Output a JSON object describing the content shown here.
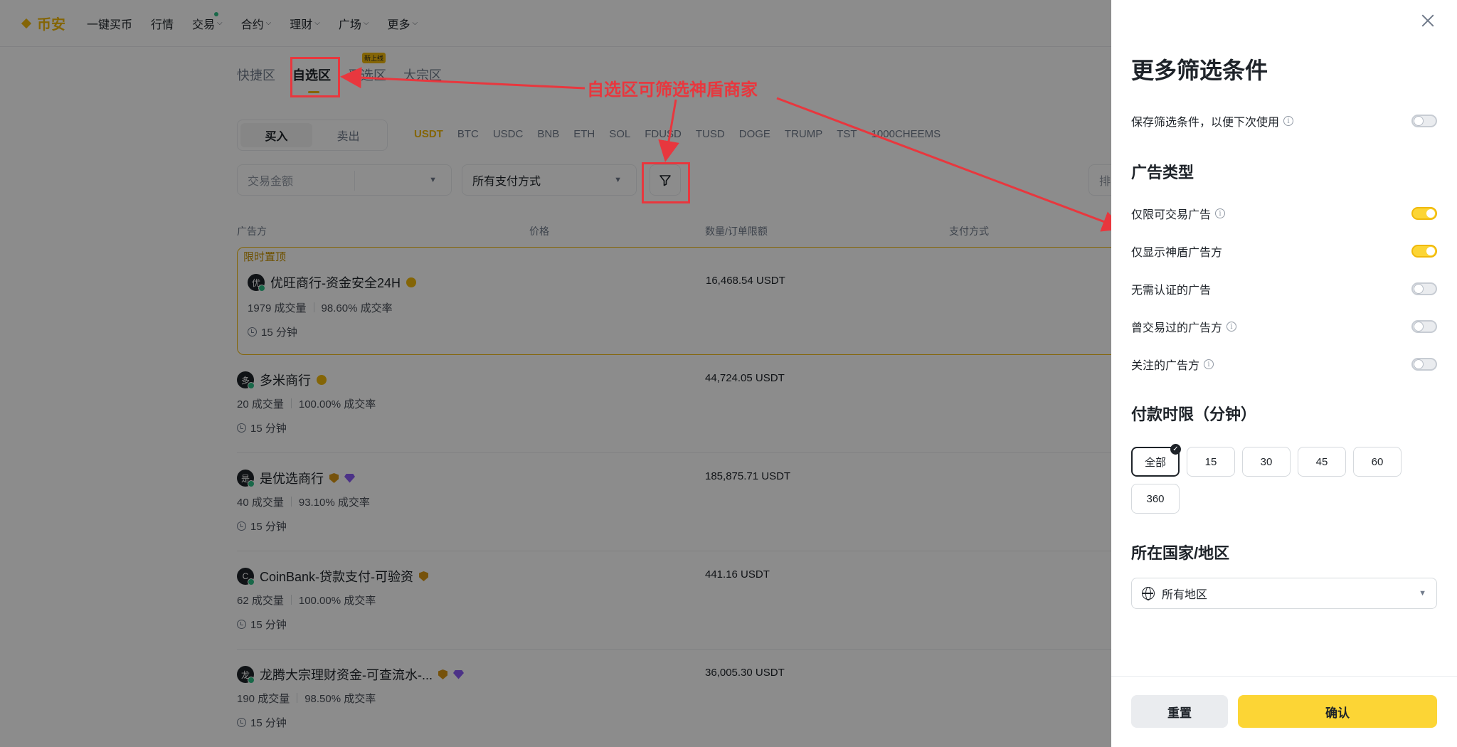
{
  "nav": {
    "logo": "币安",
    "items": [
      {
        "label": "一键买币",
        "chevron": false
      },
      {
        "label": "行情",
        "chevron": false
      },
      {
        "label": "交易",
        "chevron": true
      },
      {
        "label": "合约",
        "chevron": true
      },
      {
        "label": "理财",
        "chevron": true
      },
      {
        "label": "广场",
        "chevron": true
      },
      {
        "label": "更多",
        "chevron": true
      }
    ]
  },
  "zone_tabs": [
    {
      "label": "快捷区",
      "active": false
    },
    {
      "label": "自选区",
      "active": true
    },
    {
      "label": "严选区",
      "active": false,
      "badge": "新上线"
    },
    {
      "label": "大宗区",
      "active": false
    }
  ],
  "trade_toggle": {
    "buy": "买入",
    "sell": "卖出"
  },
  "coins": [
    "USDT",
    "BTC",
    "USDC",
    "BNB",
    "ETH",
    "SOL",
    "FDUSD",
    "TUSD",
    "DOGE",
    "TRUMP",
    "TST",
    "1000CHEEMS"
  ],
  "filters": {
    "amount_placeholder": "交易金额",
    "payment": "所有支付方式",
    "sort_stub": "排"
  },
  "columns": {
    "advertiser": "广告方",
    "price": "价格",
    "quantity": "数量/订单限额",
    "payment": "支付方式"
  },
  "pinned_label": "限时置顶",
  "ads": [
    {
      "initial": "优",
      "name": "优旺商行-资金安全24H",
      "badges": [
        "gold"
      ],
      "trades": "1979 成交量",
      "rate": "98.60% 成交率",
      "time": "15 分钟",
      "quantity": "16,468.54 USDT",
      "pinned": true
    },
    {
      "initial": "多",
      "name": "多米商行",
      "badges": [
        "gold"
      ],
      "trades": "20 成交量",
      "rate": "100.00% 成交率",
      "time": "15 分钟",
      "quantity": "44,724.05 USDT",
      "pinned": false
    },
    {
      "initial": "是",
      "name": "是优选商行",
      "badges": [
        "shield",
        "gem"
      ],
      "trades": "40 成交量",
      "rate": "93.10% 成交率",
      "time": "15 分钟",
      "quantity": "185,875.71 USDT",
      "pinned": false
    },
    {
      "initial": "C",
      "name": "CoinBank-贷款支付-可验资",
      "badges": [
        "shield"
      ],
      "trades": "62 成交量",
      "rate": "100.00% 成交率",
      "time": "15 分钟",
      "quantity": "441.16 USDT",
      "pinned": false
    },
    {
      "initial": "龙",
      "name": "龙腾大宗理财资金-可查流水-...",
      "badges": [
        "shield",
        "gem"
      ],
      "trades": "190 成交量",
      "rate": "98.50% 成交率",
      "time": "15 分钟",
      "quantity": "36,005.30 USDT",
      "pinned": false
    }
  ],
  "annotation": {
    "text": "自选区可筛选神盾商家",
    "color": "#e8373e"
  },
  "drawer": {
    "title": "更多筛选条件",
    "save_filter": {
      "label": "保存筛选条件，以便下次使用",
      "on": false
    },
    "ad_type_title": "广告类型",
    "ad_types": [
      {
        "label": "仅限可交易广告",
        "info": true,
        "on": true
      },
      {
        "label": "仅显示神盾广告方",
        "info": false,
        "on": true
      },
      {
        "label": "无需认证的广告",
        "info": false,
        "on": false
      },
      {
        "label": "曾交易过的广告方",
        "info": true,
        "on": false
      },
      {
        "label": "关注的广告方",
        "info": true,
        "on": false
      }
    ],
    "pay_limit_title": "付款时限（分钟）",
    "pay_limits": [
      {
        "label": "全部",
        "active": true
      },
      {
        "label": "15",
        "active": false
      },
      {
        "label": "30",
        "active": false
      },
      {
        "label": "45",
        "active": false
      },
      {
        "label": "60",
        "active": false
      },
      {
        "label": "360",
        "active": false
      }
    ],
    "region_title": "所在国家/地区",
    "region_value": "所有地区",
    "reset": "重置",
    "confirm": "确认"
  },
  "colors": {
    "brand": "#f0b90b",
    "confirm_bg": "#fcd535",
    "annotation": "#e8373e"
  }
}
